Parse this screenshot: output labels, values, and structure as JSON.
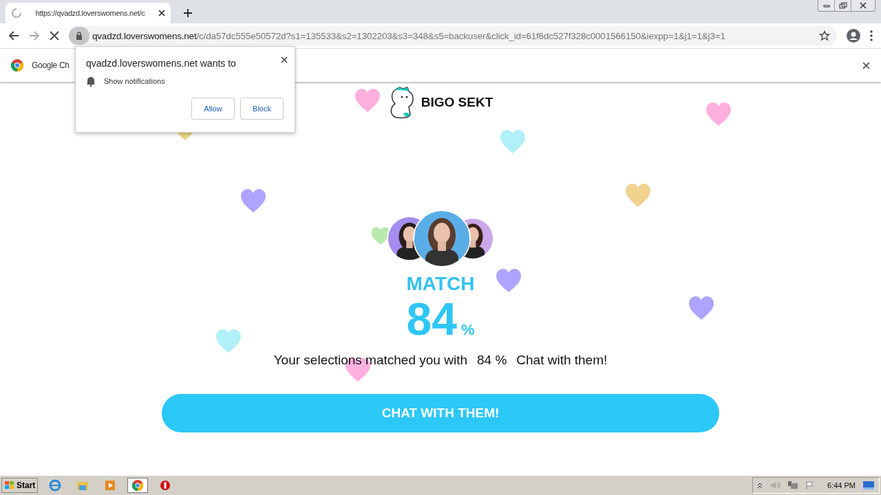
{
  "browser": {
    "tab": {
      "title": "https://qvadzd.loverswomens.net/c",
      "loading": true
    },
    "address": {
      "host": "qvadzd.loverswomens.net",
      "path": "/c/da57dc555e50572d?s1=135533&s2=1302203&s3=348&s5=backuser&click_id=61f6dc527f328c0001566150&iexpp=1&j1=1&j3=1"
    },
    "infobar": {
      "text": "Google Ch"
    }
  },
  "permission_popup": {
    "title": "qvadzd.loverswomens.net wants to",
    "request": "Show notifications",
    "buttons": [
      "Allow",
      "Block"
    ]
  },
  "page": {
    "brand": "BIGO SEKT",
    "match_label": "MATCH",
    "percent": "84",
    "percent_sign": "%",
    "sentence": [
      "Your selections matched you with",
      "84 %",
      "Chat with them!"
    ],
    "cta": "CHAT WITH THEM!"
  },
  "taskbar": {
    "start": "Start",
    "clock": "6:44 PM"
  }
}
